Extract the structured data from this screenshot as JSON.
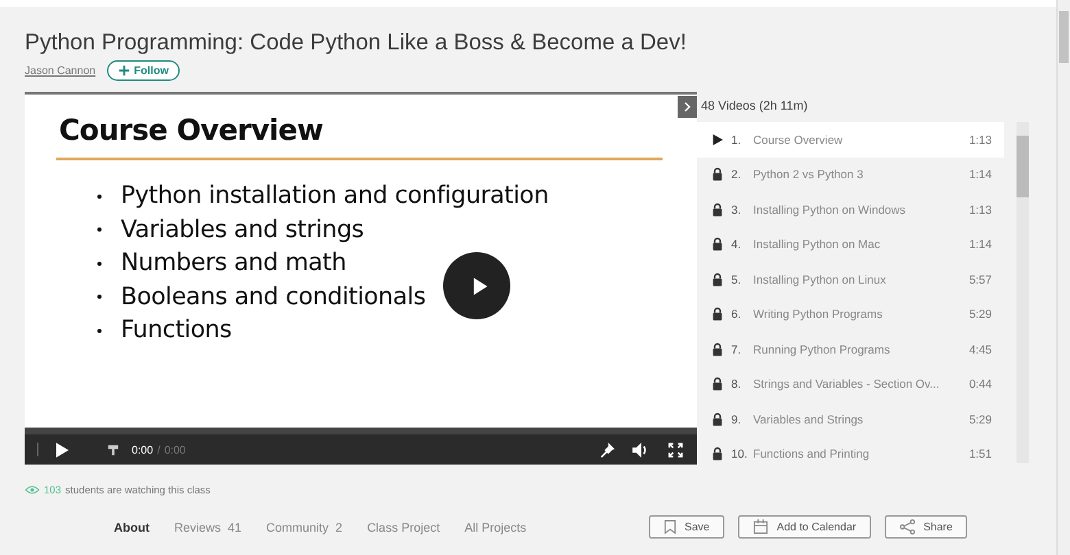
{
  "class": {
    "title": "Python Programming: Code Python Like a Boss & Become a Dev!",
    "author": "Jason Cannon",
    "follow_label": "Follow"
  },
  "player": {
    "slide_title": "Course Overview",
    "bullets": [
      "Python installation and configuration",
      "Variables and strings",
      "Numbers and math",
      "Booleans and conditionals",
      "Functions"
    ],
    "current_time": "0:00",
    "separator": "/",
    "total_time": "0:00"
  },
  "playlist": {
    "header": "48 Videos (2h 11m)",
    "lessons": [
      {
        "number": "1.",
        "title": "Course Overview",
        "duration": "1:13",
        "selected": true,
        "locked": false
      },
      {
        "number": "2.",
        "title": "Python 2 vs Python 3",
        "duration": "1:14",
        "selected": false,
        "locked": true
      },
      {
        "number": "3.",
        "title": "Installing Python on Windows",
        "duration": "1:13",
        "selected": false,
        "locked": true
      },
      {
        "number": "4.",
        "title": "Installing Python on Mac",
        "duration": "1:14",
        "selected": false,
        "locked": true
      },
      {
        "number": "5.",
        "title": "Installing Python on Linux",
        "duration": "5:57",
        "selected": false,
        "locked": true
      },
      {
        "number": "6.",
        "title": "Writing Python Programs",
        "duration": "5:29",
        "selected": false,
        "locked": true
      },
      {
        "number": "7.",
        "title": "Running Python Programs",
        "duration": "4:45",
        "selected": false,
        "locked": true
      },
      {
        "number": "8.",
        "title": "Strings and Variables - Section Ov...",
        "duration": "0:44",
        "selected": false,
        "locked": true
      },
      {
        "number": "9.",
        "title": "Variables and Strings",
        "duration": "5:29",
        "selected": false,
        "locked": true
      },
      {
        "number": "10.",
        "title": "Functions and Printing",
        "duration": "1:51",
        "selected": false,
        "locked": true
      }
    ]
  },
  "watching": {
    "count": "103",
    "text": "students are watching this class"
  },
  "tabs": [
    {
      "label": "About",
      "selected": true
    },
    {
      "label": "Reviews",
      "count": "41",
      "selected": false
    },
    {
      "label": "Community",
      "count": "2",
      "selected": false
    },
    {
      "label": "Class Project",
      "selected": false
    },
    {
      "label": "All Projects",
      "selected": false
    }
  ],
  "actions": [
    {
      "kind": "save",
      "label": "Save"
    },
    {
      "kind": "calendar",
      "label": "Add to Calendar"
    },
    {
      "kind": "share",
      "label": "Share"
    }
  ]
}
